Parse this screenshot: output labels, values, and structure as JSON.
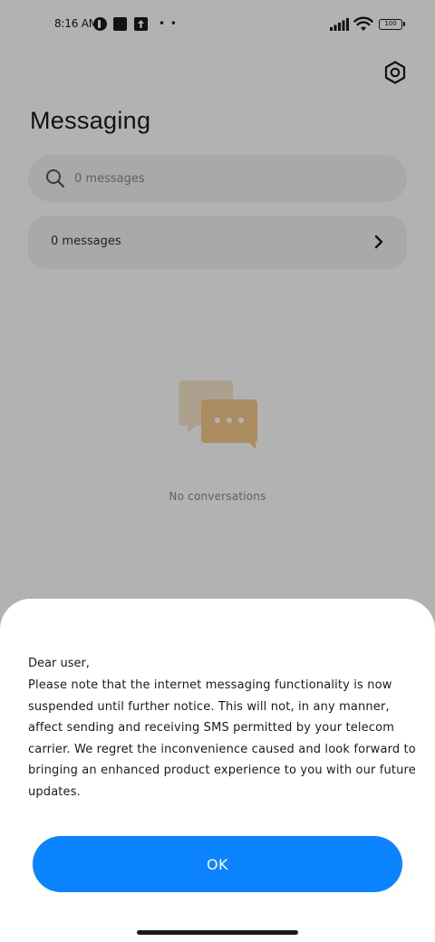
{
  "status_bar": {
    "time": "8:16 AM",
    "more": "• •",
    "battery": "100",
    "icons": [
      "notification-app-icon",
      "notification-square-icon",
      "upload-icon",
      "signal-icon",
      "wifi-icon",
      "battery-icon"
    ]
  },
  "header": {
    "title": "Messaging",
    "settings_icon": "gear-icon"
  },
  "search": {
    "placeholder": "0 messages",
    "value": ""
  },
  "messages_row": {
    "label": "0 messages"
  },
  "empty_state": {
    "text": "No conversations",
    "illustration_color": "#f5c98a"
  },
  "dialog": {
    "greeting": "Dear user,",
    "body": "Please note that the internet messaging functionality is now suspended until further notice. This will not, in any manner, affect sending and receiving SMS permitted by your telecom carrier. We regret the inconvenience caused and look forward to bringing an enhanced product experience to you with our future updates.",
    "ok_label": "OK"
  },
  "colors": {
    "accent": "#0d84ff",
    "scrim": "rgba(0,0,0,0.30)",
    "surface": "#f2f2f2"
  }
}
